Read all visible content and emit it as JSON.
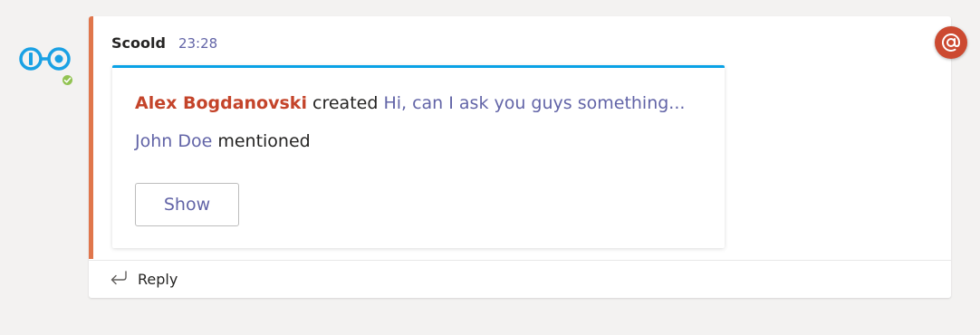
{
  "message": {
    "sender": "Scoold",
    "time": "23:28"
  },
  "card": {
    "author": "Alex Bogdanovski",
    "action_created": "created",
    "post_link": "Hi, can I ask you guys something...",
    "mentioned_user": "John Doe",
    "action_mentioned": "mentioned",
    "show_button": "Show"
  },
  "reply": {
    "label": "Reply"
  },
  "icons": {
    "avatar": "scoold-logo-icon",
    "presence": "available-check-icon",
    "reply": "reply-arrow-icon",
    "mention": "at-mention-icon"
  },
  "colors": {
    "accent_bar": "#e0764c",
    "card_top_border": "#0aa2e6",
    "author": "#c4442a",
    "link": "#6264a7",
    "presence": "#92c353",
    "mention_badge": "#cc4a31",
    "logo": "#1aa1e4"
  }
}
